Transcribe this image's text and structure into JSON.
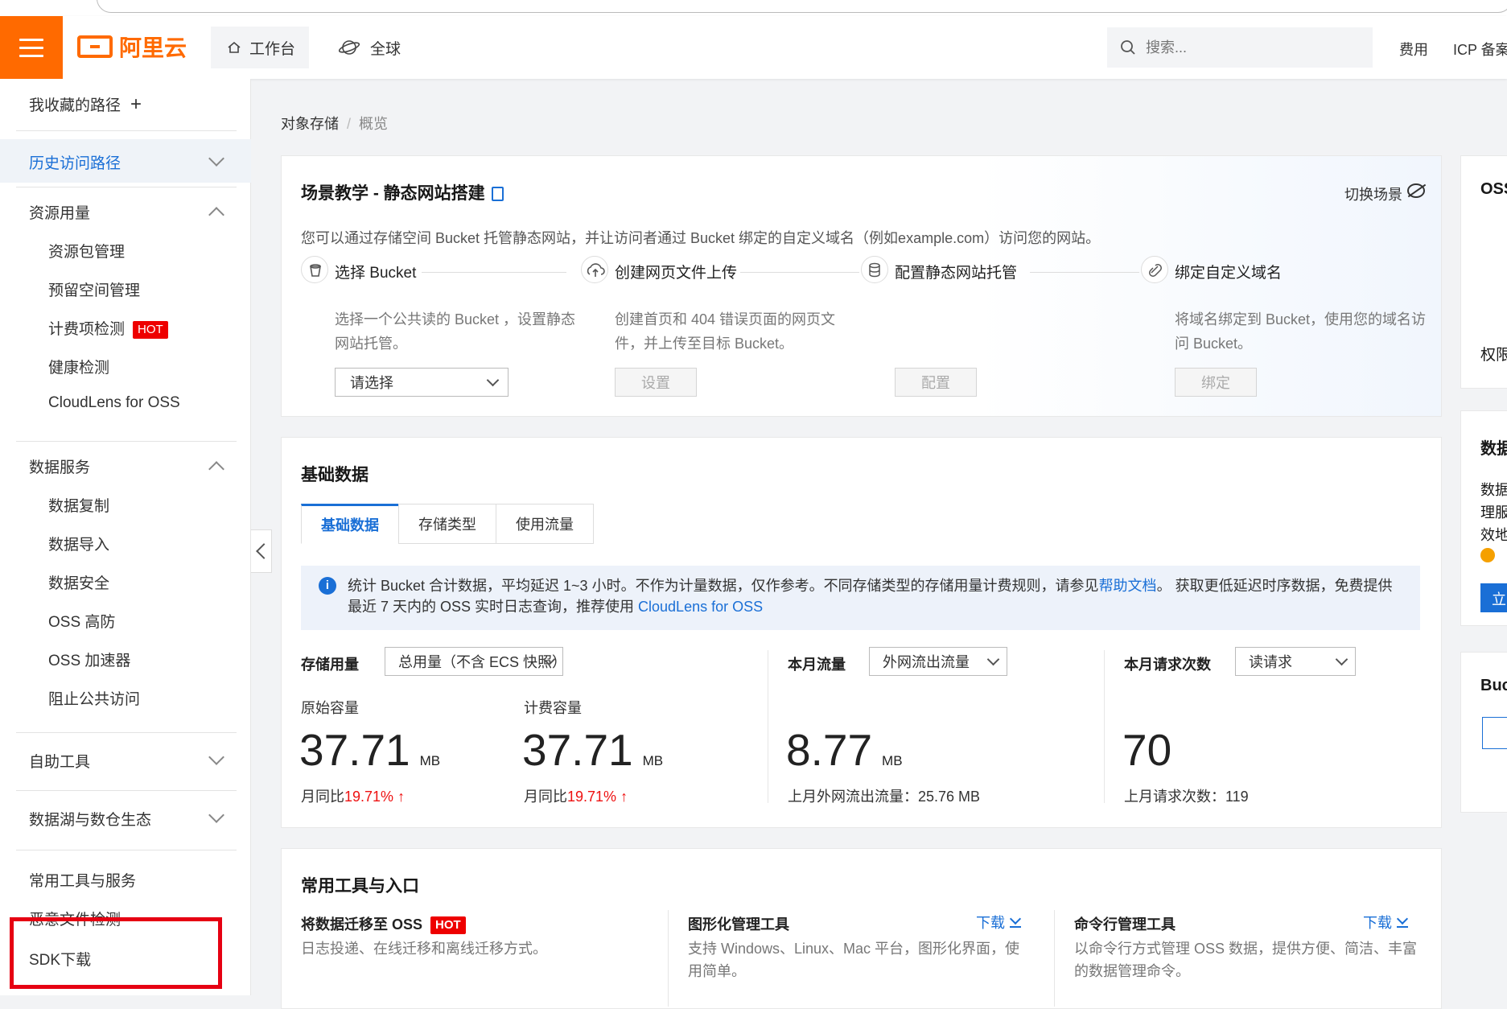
{
  "topnav": {
    "logo_text": "阿里云",
    "workbench": "工作台",
    "global": "全球",
    "search_placeholder": "搜索...",
    "fee": "费用",
    "icp": "ICP 备案"
  },
  "sidebar": {
    "favorites": "我收藏的路径",
    "history": "历史访问路径",
    "resource_usage": "资源用量",
    "resource_items": [
      "资源包管理",
      "预留空间管理",
      "计费项检测",
      "健康检测",
      "CloudLens for OSS"
    ],
    "hot_badge": "HOT",
    "data_services": "数据服务",
    "data_items": [
      "数据复制",
      "数据导入",
      "数据安全",
      "OSS 高防",
      "OSS 加速器",
      "阻止公共访问"
    ],
    "self_tools": "自助工具",
    "data_lake": "数据湖与数仓生态",
    "common_tools": "常用工具与服务",
    "malicious_check": "恶意文件检测",
    "sdk_download": "SDK下载"
  },
  "breadcrumb": {
    "root": "对象存储",
    "sep": "/",
    "current": "概览"
  },
  "scene": {
    "title": "场景教学 - 静态网站搭建",
    "switch": "切换场景",
    "desc": "您可以通过存储空间 Bucket 托管静态网站，并让访问者通过 Bucket 绑定的自定义域名（例如example.com）访问您的网站。",
    "steps": [
      {
        "title": "选择 Bucket",
        "desc": "选择一个公共读的 Bucket ，设置静态网站托管。",
        "action": "请选择"
      },
      {
        "title": "创建网页文件上传",
        "desc": "创建首页和 404 错误页面的网页文件，并上传至目标 Bucket。",
        "action": "设置"
      },
      {
        "title": "配置静态网站托管",
        "desc": "",
        "action": "配置"
      },
      {
        "title": "绑定自定义域名",
        "desc": "将域名绑定到 Bucket，使用您的域名访问 Bucket。",
        "action": "绑定"
      }
    ]
  },
  "basic": {
    "title": "基础数据",
    "tabs": [
      "基础数据",
      "存储类型",
      "使用流量"
    ],
    "info_line1a": "统计 Bucket 合计数据，平均延迟 1~3 小时。不作为计量数据，仅作参考。不同存储类型的存储用量计费规则，请参见",
    "info_link1": "帮助文档",
    "info_line1b": "。 获取更低延迟时序数据，免费提供",
    "info_line2a": "最近 7 天内的 OSS 实时日志查询，推荐使用 ",
    "info_link2": "CloudLens for OSS",
    "storage": {
      "label": "存储用量",
      "select": "总用量（不含 ECS 快照）",
      "raw_label": "原始容量",
      "raw_value": "37.71",
      "raw_unit": "MB",
      "raw_mom_prefix": "月同比",
      "raw_mom_pct": "19.71%",
      "bill_label": "计费容量",
      "bill_value": "37.71",
      "bill_unit": "MB",
      "bill_mom_prefix": "月同比",
      "bill_mom_pct": "19.71%"
    },
    "traffic": {
      "label": "本月流量",
      "select": "外网流出流量",
      "value": "8.77",
      "unit": "MB",
      "last": "上月外网流出流量：25.76 MB"
    },
    "requests": {
      "label": "本月请求次数",
      "select": "读请求",
      "value": "70",
      "last": "上月请求次数：119"
    }
  },
  "tools": {
    "title": "常用工具与入口",
    "cols": [
      {
        "title": "将数据迁移至 OSS",
        "desc": "日志投递、在线迁移和离线迁移方式。",
        "link": ""
      },
      {
        "title": "图形化管理工具",
        "desc": "支持 Windows、Linux、Mac 平台，图形化界面，使用简单。",
        "link": "下载"
      },
      {
        "title": "命令行管理工具",
        "desc": "以命令行方式管理 OSS 数据，提供方便、简洁、丰富的数据管理命令。",
        "link": "下载"
      }
    ]
  },
  "right_partial": {
    "oss": "OSS",
    "perm": "权限",
    "data": "数据",
    "data_lines": [
      "数据",
      "理服",
      "效地"
    ],
    "buc": "Buc",
    "btn": "立"
  },
  "colors": {
    "brand": "#ff6a00",
    "link": "#1a6fd6",
    "highlight_box": "#e60012"
  }
}
